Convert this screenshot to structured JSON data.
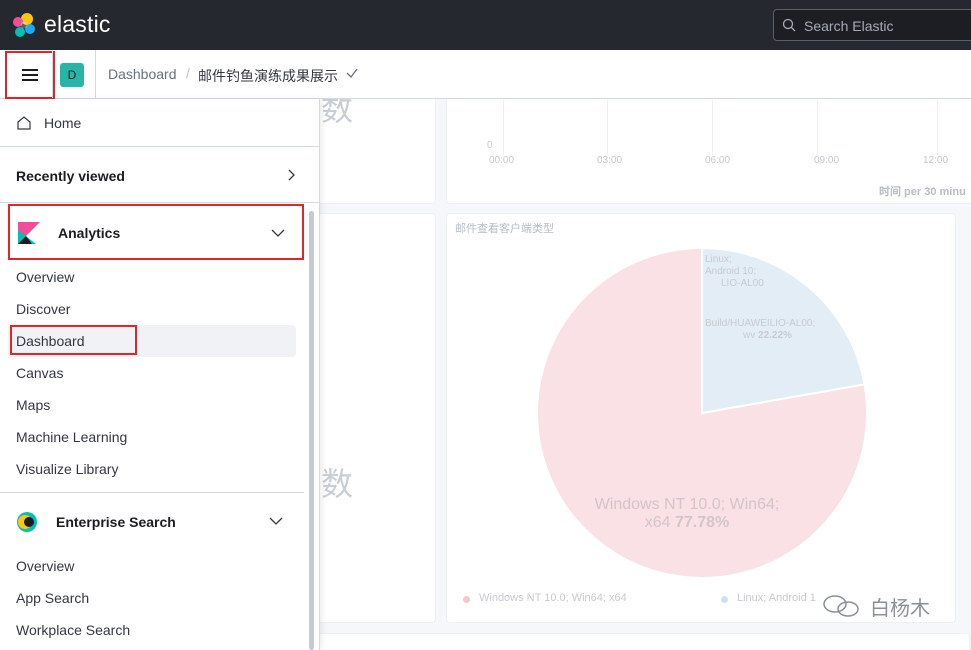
{
  "header": {
    "brand": "elastic",
    "search_placeholder": "Search Elastic"
  },
  "subbar": {
    "space_initial": "D",
    "breadcrumb_parent": "Dashboard",
    "breadcrumb_separator": "/",
    "breadcrumb_current": "邮件钓鱼演练成果展示"
  },
  "nav": {
    "home": "Home",
    "recently_viewed": "Recently viewed",
    "analytics": {
      "label": "Analytics",
      "items": [
        "Overview",
        "Discover",
        "Dashboard",
        "Canvas",
        "Maps",
        "Machine Learning",
        "Visualize Library"
      ],
      "active": "Dashboard"
    },
    "enterprise_search": {
      "label": "Enterprise Search",
      "items": [
        "Overview",
        "App Search",
        "Workplace Search"
      ]
    }
  },
  "dashboard": {
    "ghost_text_top": "数",
    "ghost_text_mid": "数",
    "time_axis": {
      "zero_label": "0",
      "ticks": [
        "00:00",
        "03:00",
        "06:00",
        "09:00",
        "12:00"
      ],
      "title": "时间 per 30 minu"
    },
    "pie_panel": {
      "title": "邮件查看客户端类型",
      "slices": [
        {
          "label_line1": "Windows NT 10.0; Win64;",
          "label_line2": "x64",
          "percent": "77.78%",
          "value": 77.78,
          "color": "#f9e1e6"
        },
        {
          "label_line1": "Linux;",
          "label_line2": "Android 10;",
          "label_line3": "LIO-AL00",
          "label_line4": "Build/HUAWEILIO-AL00;",
          "label_line5": "wv",
          "percent": "22.22%",
          "value": 22.22,
          "color": "#e3edf6"
        }
      ],
      "legend": [
        "Windows NT 10.0; Win64; x64",
        "Linux; Android 1"
      ]
    }
  },
  "watermark": "白杨木",
  "colors": {
    "header_bg": "#25282f",
    "accent_teal": "#26b6a8",
    "highlight_red": "#e0262a"
  }
}
